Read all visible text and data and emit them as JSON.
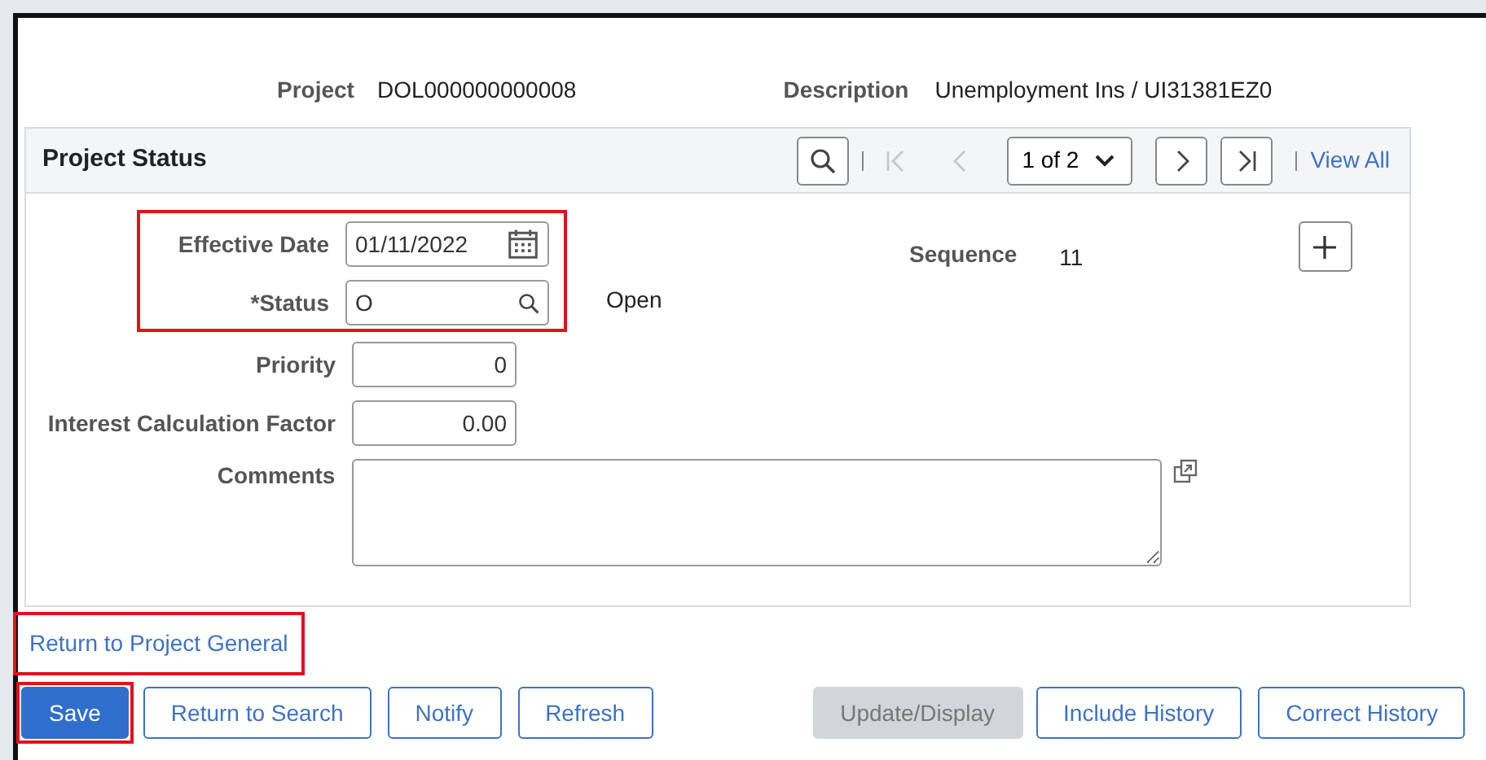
{
  "header": {
    "project_label": "Project",
    "project_value": "DOL000000000008",
    "description_label": "Description",
    "description_value": "Unemployment Ins / UI31381EZ0"
  },
  "panel": {
    "title": "Project Status",
    "nav": {
      "page_select": "1 of 2",
      "first_disabled": true,
      "prev_disabled": true,
      "next_disabled": false,
      "last_disabled": false,
      "view_all": "View All"
    },
    "highlighted_fields": {
      "highlighted": true,
      "fields": [
        {
          "label": "Effective Date",
          "value": "01/11/2022",
          "kind": "date"
        },
        {
          "label": "*Status",
          "value": "O",
          "kind": "lookup",
          "note": "Open"
        }
      ]
    },
    "fields": [
      {
        "label": "Priority",
        "value": "0",
        "kind": "number"
      },
      {
        "label": "Interest Calculation Factor",
        "value": "0.00",
        "kind": "number"
      },
      {
        "label": "Comments",
        "kind": "textarea"
      }
    ],
    "sequence_label": "Sequence",
    "sequence_value": "11"
  },
  "return_link": {
    "text": "Return to Project General",
    "highlighted": true
  },
  "buttons": [
    {
      "label": "Save",
      "kind": "primary",
      "disabled": false,
      "highlighted": true
    },
    {
      "label": "Return to Search",
      "kind": "secondary",
      "disabled": false,
      "highlighted": false
    },
    {
      "label": "Notify",
      "kind": "secondary",
      "disabled": false,
      "highlighted": false
    },
    {
      "label": "Refresh",
      "kind": "secondary",
      "disabled": false,
      "highlighted": false
    },
    {
      "label": "Update/Display",
      "kind": "secondary",
      "disabled": true,
      "highlighted": false
    },
    {
      "label": "Include History",
      "kind": "secondary",
      "disabled": false,
      "highlighted": false
    },
    {
      "label": "Correct History",
      "kind": "secondary",
      "disabled": false,
      "highlighted": false
    }
  ]
}
